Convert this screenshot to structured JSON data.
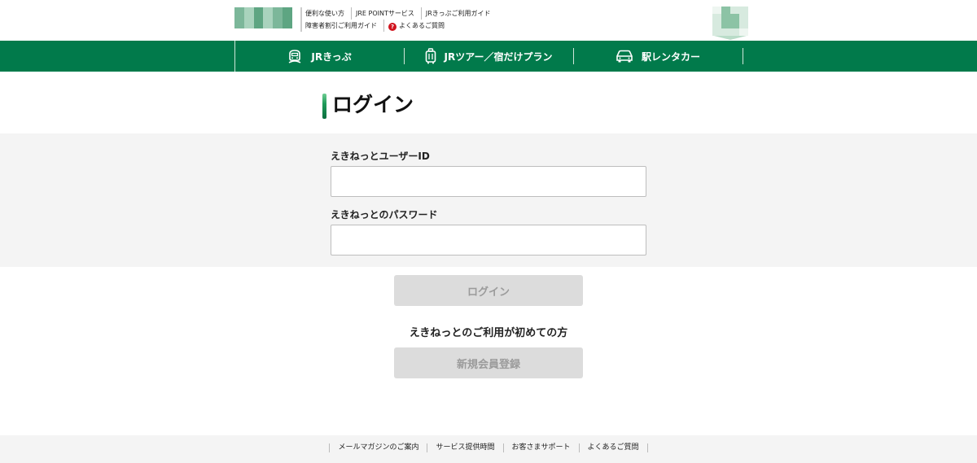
{
  "header": {
    "util_links_row1": [
      "便利な使い方",
      "JRE POINTサービス",
      "JRきっぷご利用ガイド"
    ],
    "util_links_row2": [
      "障害者割引ご利用ガイド",
      "よくあるご質問"
    ],
    "help_icon_glyph": "?"
  },
  "nav": {
    "items": [
      {
        "label": "JRきっぷ",
        "icon": "train-icon"
      },
      {
        "label": "JRツアー／宿だけプラン",
        "icon": "luggage-icon"
      },
      {
        "label": "駅レンタカー",
        "icon": "car-icon"
      }
    ]
  },
  "page": {
    "title": "ログイン"
  },
  "form": {
    "user_id_label": "えきねっとユーザーID",
    "user_id_value": "",
    "password_label": "えきねっとのパスワード",
    "password_value": "",
    "login_button": "ログイン",
    "first_time_text": "えきねっとのご利用が初めての方",
    "register_button": "新規会員登録"
  },
  "footer": {
    "links": [
      "メールマガジンのご案内",
      "サービス提供時間",
      "お客さまサポート",
      "よくあるご質問"
    ]
  },
  "colors": {
    "nav_green": "#017a4b",
    "disabled_button": "#dcdcdc",
    "help_red": "#d0131e"
  }
}
